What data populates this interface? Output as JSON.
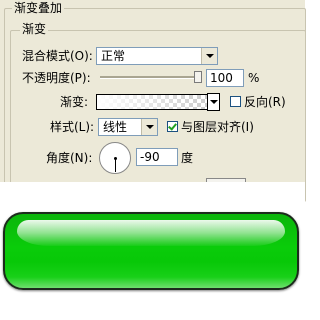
{
  "group": {
    "title": "渐变叠加",
    "subtitle": "渐变"
  },
  "blend_mode": {
    "label": "混合模式(O):",
    "value": "正常"
  },
  "opacity": {
    "label": "不透明度(P):",
    "value": "100",
    "unit": "%",
    "slider_fraction": 1.0
  },
  "gradient": {
    "label": "渐变:",
    "reverse_label": "反向(R)",
    "reverse_checked": false
  },
  "style": {
    "label": "样式(L):",
    "value": "线性",
    "align_label": "与图层对齐(I)",
    "align_checked": true
  },
  "angle": {
    "label": "角度(N):",
    "value": "-90",
    "unit": "度"
  }
}
